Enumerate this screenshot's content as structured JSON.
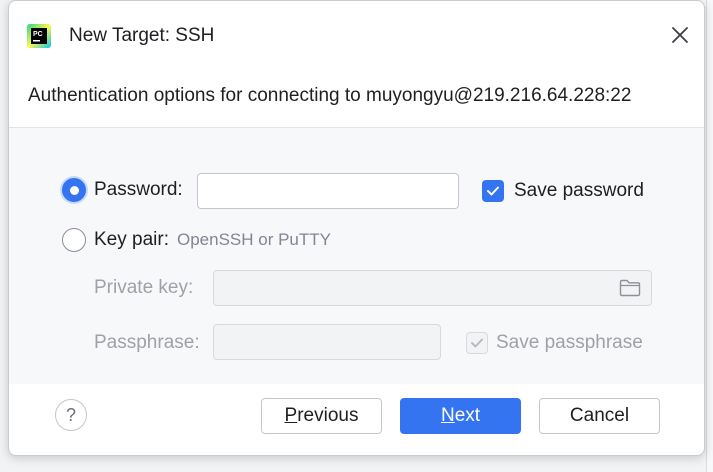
{
  "dialog": {
    "title": "New Target: SSH",
    "subtitle": "Authentication options for connecting to muyongyu@219.216.64.228:22"
  },
  "auth": {
    "password_label": "Password:",
    "password_value": "",
    "save_password_label": "Save password",
    "save_password_checked": true,
    "keypair_label": "Key pair:",
    "keypair_hint": "OpenSSH or PuTTY",
    "private_key_label": "Private key:",
    "private_key_value": "",
    "passphrase_label": "Passphrase:",
    "passphrase_value": "",
    "save_passphrase_label": "Save passphrase",
    "save_passphrase_checked": true,
    "selected_method": "password"
  },
  "footer": {
    "help_label": "?",
    "previous_mnemonic": "P",
    "previous_rest": "revious",
    "next_mnemonic": "N",
    "next_rest": "ext",
    "cancel_label": "Cancel"
  },
  "icons": {
    "app": "pycharm-icon",
    "close": "close-icon",
    "folder": "folder-icon",
    "help": "help-icon"
  },
  "colors": {
    "accent": "#3574f0",
    "disabled_text": "#9ea1a8",
    "panel_bg": "#f7f8fa"
  }
}
